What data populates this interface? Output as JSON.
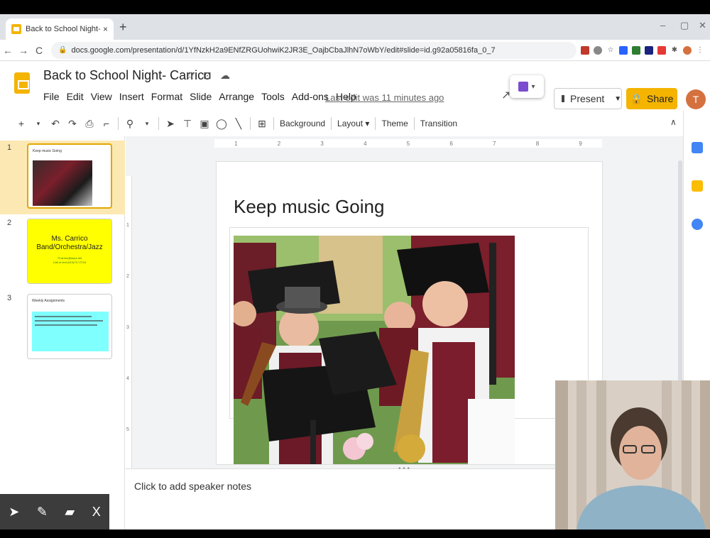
{
  "browser": {
    "tab_title": "Back to School Night- Carrico - G",
    "tab_close": "×",
    "new_tab": "+",
    "minimize": "–",
    "restore": "▢",
    "close": "✕",
    "back": "←",
    "forward": "→",
    "reload": "C",
    "url": "docs.google.com/presentation/d/1YfNzkH2a9ENfZRGUohwiK2JR3E_OajbCbaJlhN7oWbY/edit#slide=id.g92a05816fa_0_7",
    "menu_dots": "⋮"
  },
  "doc": {
    "title": "Back to School Night- Carrico",
    "star_icon": "☆",
    "move_icon": "⊡",
    "cloud_icon": "☁",
    "menu": [
      "File",
      "Edit",
      "View",
      "Insert",
      "Format",
      "Slide",
      "Arrange",
      "Tools",
      "Add-ons",
      "Help"
    ],
    "last_edit": "Last edit was 11 minutes ago",
    "present_label": "Present",
    "share_label": "Share",
    "avatar_initial": "T"
  },
  "toolbar": {
    "background": "Background",
    "layout": "Layout",
    "theme": "Theme",
    "transition": "Transition"
  },
  "ruler": {
    "top": [
      "1",
      "2",
      "3",
      "4",
      "5",
      "6",
      "7",
      "8",
      "9"
    ],
    "left": [
      "1",
      "2",
      "3",
      "4",
      "5"
    ]
  },
  "slides": [
    {
      "number": "1",
      "title": "Keep music Going"
    },
    {
      "number": "2",
      "name_lines": [
        "Ms. Carrico",
        "Band/Orchestra/Jazz"
      ],
      "contact": "TCarrico@acps.net\nCall or text (910)717-0716"
    },
    {
      "number": "3",
      "title": "Weekly Assignments"
    }
  ],
  "current_slide": {
    "title": "Keep music Going"
  },
  "notes": {
    "placeholder": "Click to add speaker notes",
    "grip": "• • •"
  },
  "pen_toolbar": {
    "pointer": "➤",
    "pen": "✎",
    "highlighter": "▰",
    "close": "X"
  },
  "colors": {
    "accent": "#f4b400",
    "active_slide_bg": "#fce8b2",
    "slide2_bg": "#ffff00",
    "slide3_box": "#80ffff"
  }
}
